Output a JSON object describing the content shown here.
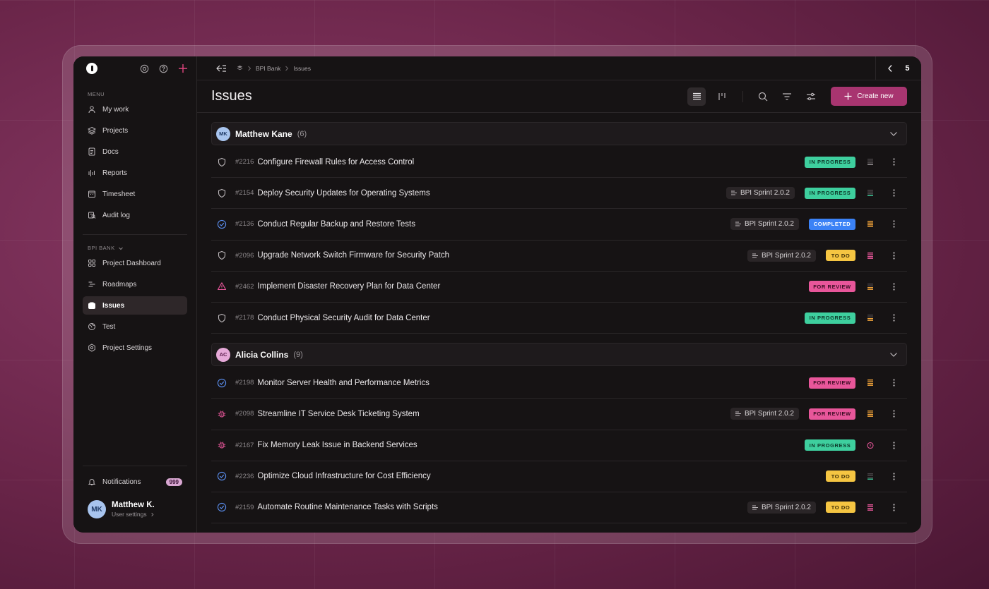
{
  "sidebar": {
    "menu_label": "MENU",
    "items": [
      {
        "label": "My work",
        "icon": "user-icon"
      },
      {
        "label": "Projects",
        "icon": "layers-icon"
      },
      {
        "label": "Docs",
        "icon": "document-icon"
      },
      {
        "label": "Reports",
        "icon": "bars-icon"
      },
      {
        "label": "Timesheet",
        "icon": "calendar-icon"
      },
      {
        "label": "Audit log",
        "icon": "audit-icon"
      }
    ],
    "workspace_label": "BPI BANK",
    "project_items": [
      {
        "label": "Project Dashboard",
        "icon": "grid-icon"
      },
      {
        "label": "Roadmaps",
        "icon": "roadmap-icon"
      },
      {
        "label": "Issues",
        "icon": "issues-icon",
        "active": true
      },
      {
        "label": "Test",
        "icon": "test-icon"
      },
      {
        "label": "Project Settings",
        "icon": "settings-icon"
      }
    ],
    "notifications_label": "Notifications",
    "notifications_count": "999",
    "user": {
      "initials": "MK",
      "name": "Matthew K.",
      "settings_label": "User settings"
    }
  },
  "breadcrumb": {
    "project": "BPI Bank",
    "page": "Issues"
  },
  "pager": {
    "value": "5"
  },
  "page_title": "Issues",
  "create_label": "Create new",
  "colors": {
    "accent": "#a83570",
    "in_progress": "#3ecf9e",
    "completed": "#3b82f6",
    "todo": "#f5c542",
    "for_review": "#e8569a"
  },
  "groups": [
    {
      "initials": "MK",
      "name": "Matthew Kane",
      "count": "(6)",
      "avatar_bg": "#a8c4ee",
      "avatar_fg": "#1f3a66",
      "issues": [
        {
          "type": "shield",
          "id": "#2216",
          "title": "Configure Firewall Rules for Access Control",
          "sprint": "",
          "status": "IN PROGRESS",
          "status_key": "in_progress",
          "priority": "low"
        },
        {
          "type": "shield",
          "id": "#2154",
          "title": "Deploy Security Updates for Operating Systems",
          "sprint": "BPI Sprint 2.0.2",
          "status": "IN PROGRESS",
          "status_key": "in_progress",
          "priority": "low-green"
        },
        {
          "type": "check",
          "id": "#2136",
          "title": "Conduct Regular Backup and Restore Tests",
          "sprint": "BPI Sprint 2.0.2",
          "status": "COMPLETED",
          "status_key": "completed",
          "priority": "high"
        },
        {
          "type": "shield",
          "id": "#2096",
          "title": "Upgrade Network Switch Firmware for Security Patch",
          "sprint": "BPI Sprint 2.0.2",
          "status": "TO DO",
          "status_key": "todo",
          "priority": "urgent"
        },
        {
          "type": "warning",
          "id": "#2462",
          "title": "Implement Disaster Recovery Plan for Data Center",
          "sprint": "",
          "status": "FOR REVIEW",
          "status_key": "for_review",
          "priority": "medium"
        },
        {
          "type": "shield",
          "id": "#2178",
          "title": "Conduct Physical Security Audit for Data Center",
          "sprint": "",
          "status": "IN PROGRESS",
          "status_key": "in_progress",
          "priority": "medium"
        }
      ]
    },
    {
      "initials": "AC",
      "name": "Alicia Collins",
      "count": "(9)",
      "avatar_bg": "#e6a9d8",
      "avatar_fg": "#5a1a4a",
      "issues": [
        {
          "type": "check",
          "id": "#2198",
          "title": "Monitor Server Health and Performance Metrics",
          "sprint": "",
          "status": "FOR REVIEW",
          "status_key": "for_review",
          "priority": "high"
        },
        {
          "type": "bug",
          "id": "#2098",
          "title": "Streamline IT Service Desk Ticketing System",
          "sprint": "BPI Sprint 2.0.2",
          "status": "FOR REVIEW",
          "status_key": "for_review",
          "priority": "high"
        },
        {
          "type": "bug",
          "id": "#2167",
          "title": "Fix Memory Leak Issue in Backend Services",
          "sprint": "",
          "status": "IN PROGRESS",
          "status_key": "in_progress",
          "priority": "alert"
        },
        {
          "type": "check",
          "id": "#2236",
          "title": "Optimize Cloud Infrastructure for Cost Efficiency",
          "sprint": "",
          "status": "TO DO",
          "status_key": "todo",
          "priority": "low-green"
        },
        {
          "type": "check",
          "id": "#2159",
          "title": "Automate Routine Maintenance Tasks with Scripts",
          "sprint": "BPI Sprint 2.0.2",
          "status": "TO DO",
          "status_key": "todo",
          "priority": "urgent"
        }
      ]
    }
  ]
}
